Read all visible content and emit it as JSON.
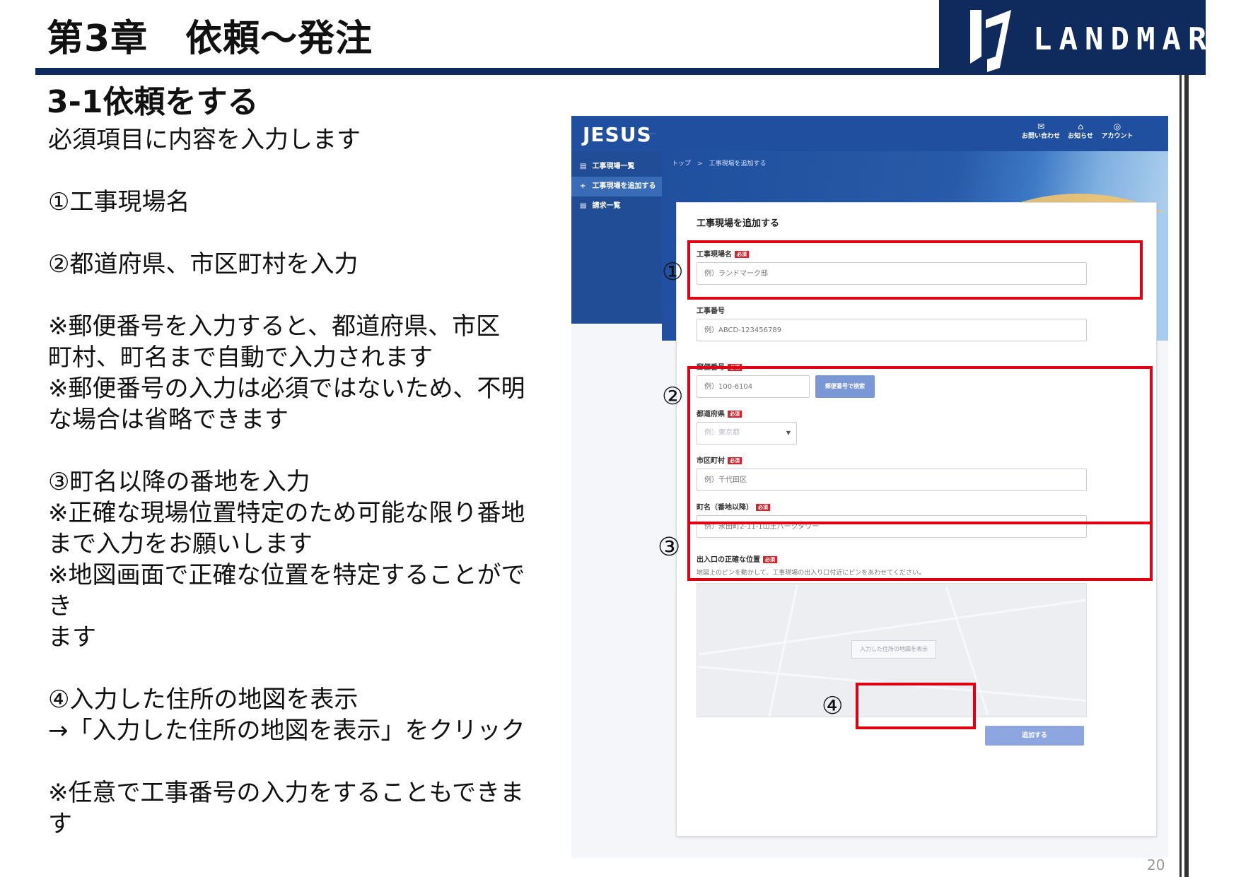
{
  "slide": {
    "chapter_title": "第3章　依頼〜発注",
    "section_title": "3-1依頼をする",
    "logo_text": "LANDMARK",
    "page_number": "20"
  },
  "instructions": [
    "必須項目に内容を入力します",
    "",
    "①工事現場名",
    "",
    "②都道府県、市区町村を入力",
    "",
    "※郵便番号を入力すると、都道府県、市区",
    "町村、町名まで自動で入力されます",
    "※郵便番号の入力は必須ではないため、不明",
    "な場合は省略できます",
    "",
    "③町名以降の番地を入力",
    "※正確な現場位置特定のため可能な限り番地",
    "まで入力をお願いします",
    "※地図画面で正確な位置を特定することができ",
    "ます",
    "",
    "④入力した住所の地図を表示",
    "→「入力した住所の地図を表示」をクリック",
    "",
    "※任意で工事番号の入力をすることもできます"
  ],
  "callout_numbers": [
    "①",
    "②",
    "③",
    "④"
  ],
  "app": {
    "brand": "JESUS",
    "top_nav": [
      {
        "icon": "mail-icon",
        "glyph": "✉",
        "label": "お問い合わせ"
      },
      {
        "icon": "bell-icon",
        "glyph": "⌂",
        "label": "お知らせ"
      },
      {
        "icon": "account-icon",
        "glyph": "◎",
        "label": "アカウント"
      }
    ],
    "sidebar": [
      {
        "icon": "list-icon",
        "glyph": "▤",
        "label": "工事現場一覧"
      },
      {
        "icon": "plus-icon",
        "glyph": "+",
        "label": "工事現場を追加する"
      },
      {
        "icon": "invoice-icon",
        "glyph": "▤",
        "label": "請求一覧"
      }
    ],
    "breadcrumb": "トップ　>　工事現場を追加する",
    "form": {
      "title": "工事現場を追加する",
      "required_badge": "必須",
      "site_name": {
        "label": "工事現場名",
        "placeholder": "例）ランドマーク邸"
      },
      "project_number": {
        "label": "工事番号",
        "placeholder": "例）ABCD-123456789"
      },
      "postal_code": {
        "label": "郵便番号",
        "placeholder": "例）100-6104",
        "button": "郵便番号で検索"
      },
      "prefecture": {
        "label": "都道府県",
        "placeholder": "例）東京都"
      },
      "city": {
        "label": "市区町村",
        "placeholder": "例）千代田区"
      },
      "town": {
        "label": "町名（番地以降）",
        "placeholder": "例）永田町2-11-1山王パークタワー"
      },
      "location": {
        "label": "出入口の正確な位置",
        "hint": "地図上のピンを動かして、工事現場の出入り口付近にピンをあわせてください。",
        "map_button": "入力した住所の地図を表示"
      },
      "submit": "追加する"
    }
  },
  "colors": {
    "navy": "#0f2a5c",
    "app_blue": "#1f4f9e",
    "callout_red": "#e00012",
    "required_red": "#d9222a"
  }
}
